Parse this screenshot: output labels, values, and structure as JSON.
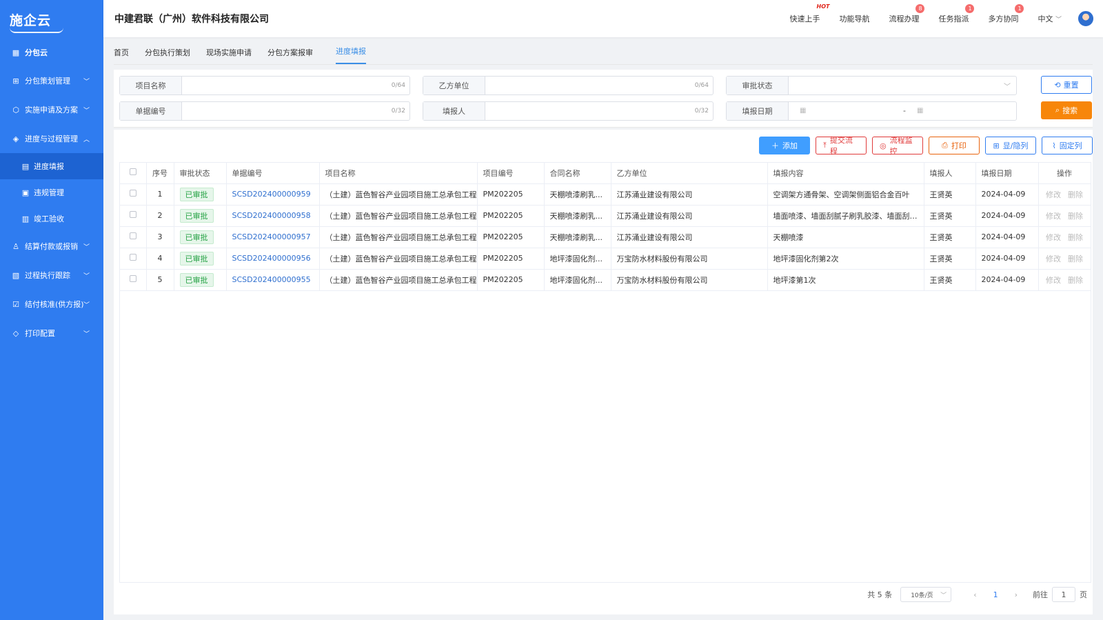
{
  "sidebar": {
    "logo": "施企云",
    "top_item": "分包云",
    "groups": [
      {
        "label": "分包策划管理",
        "icon": "grid-icon"
      },
      {
        "label": "实施申请及方案",
        "icon": "cube-icon"
      },
      {
        "label": "进度与过程管理",
        "icon": "layers-icon",
        "expanded": true,
        "children": [
          {
            "label": "进度填报",
            "icon": "report-icon",
            "active": true
          },
          {
            "label": "违规管理",
            "icon": "clipboard-icon"
          },
          {
            "label": "竣工验收",
            "icon": "building-icon"
          }
        ]
      },
      {
        "label": "结算付款或报销",
        "icon": "org-icon"
      },
      {
        "label": "过程执行跟踪",
        "icon": "chart-icon"
      },
      {
        "label": "结付核准(供方报)",
        "icon": "check-icon"
      },
      {
        "label": "打印配置",
        "icon": "stack-icon"
      }
    ]
  },
  "header": {
    "company": "中建君联（广州）软件科技有限公司",
    "links": [
      {
        "label": "快速上手",
        "hot": "HOT"
      },
      {
        "label": "功能导航"
      },
      {
        "label": "流程办理",
        "badge": "8"
      },
      {
        "label": "任务指派",
        "badge": "1"
      },
      {
        "label": "多方协同",
        "badge": "1"
      }
    ],
    "language": "中文"
  },
  "tabs": [
    {
      "label": "首页"
    },
    {
      "label": "分包执行策划"
    },
    {
      "label": "现场实施申请"
    },
    {
      "label": "分包方案报审"
    },
    {
      "label": "进度填报",
      "active": true
    }
  ],
  "search": {
    "project_name": {
      "label": "项目名称",
      "count": "0/64"
    },
    "party_b": {
      "label": "乙方单位",
      "count": "0/64"
    },
    "approval_status": {
      "label": "审批状态"
    },
    "doc_no": {
      "label": "单据编号",
      "count": "0/32"
    },
    "reporter": {
      "label": "填报人",
      "count": "0/32"
    },
    "report_date": {
      "label": "填报日期",
      "separator": "-"
    },
    "reset": "重置",
    "search": "搜索"
  },
  "toolbar": {
    "add": "添加",
    "submit": "提交流程",
    "monitor": "流程监控",
    "print": "打印",
    "toggle_cols": "显/隐列",
    "fix_cols": "固定列"
  },
  "table": {
    "headers": [
      "序号",
      "审批状态",
      "单据编号",
      "项目名称",
      "项目编号",
      "合同名称",
      "乙方单位",
      "填报内容",
      "填报人",
      "填报日期",
      "操作"
    ],
    "rows": [
      {
        "no": "1",
        "status": "已审批",
        "doc": "SCSD202400000959",
        "project": "（土建）蓝色智谷产业园项目施工总承包工程",
        "code": "PM202205",
        "contract": "天棚喷漆刷乳...",
        "party": "江苏涌业建设有限公司",
        "content": "空调架方通骨架、空调架侧面铝合金百叶",
        "reporter": "王贤英",
        "date": "2024-04-09"
      },
      {
        "no": "2",
        "status": "已审批",
        "doc": "SCSD202400000958",
        "project": "（土建）蓝色智谷产业园项目施工总承包工程",
        "code": "PM202205",
        "contract": "天棚喷漆刷乳...",
        "party": "江苏涌业建设有限公司",
        "content": "墙面喷漆、墙面刮腻子刷乳胶漆、墙面刮防...",
        "reporter": "王贤英",
        "date": "2024-04-09"
      },
      {
        "no": "3",
        "status": "已审批",
        "doc": "SCSD202400000957",
        "project": "（土建）蓝色智谷产业园项目施工总承包工程",
        "code": "PM202205",
        "contract": "天棚喷漆刷乳...",
        "party": "江苏涌业建设有限公司",
        "content": "天棚喷漆",
        "reporter": "王贤英",
        "date": "2024-04-09"
      },
      {
        "no": "4",
        "status": "已审批",
        "doc": "SCSD202400000956",
        "project": "（土建）蓝色智谷产业园项目施工总承包工程",
        "code": "PM202205",
        "contract": "地坪漆固化剂...",
        "party": "万宝防水材料股份有限公司",
        "content": "地坪漆固化剂第2次",
        "reporter": "王贤英",
        "date": "2024-04-09"
      },
      {
        "no": "5",
        "status": "已审批",
        "doc": "SCSD202400000955",
        "project": "（土建）蓝色智谷产业园项目施工总承包工程",
        "code": "PM202205",
        "contract": "地坪漆固化剂...",
        "party": "万宝防水材料股份有限公司",
        "content": "地坪漆第1次",
        "reporter": "王贤英",
        "date": "2024-04-09"
      }
    ],
    "actions": {
      "edit": "修改",
      "delete": "删除"
    }
  },
  "pager": {
    "total": "共 5 条",
    "page_size": "10条/页",
    "current": "1",
    "goto_label": "前往",
    "goto_value": "1",
    "page_unit": "页"
  }
}
